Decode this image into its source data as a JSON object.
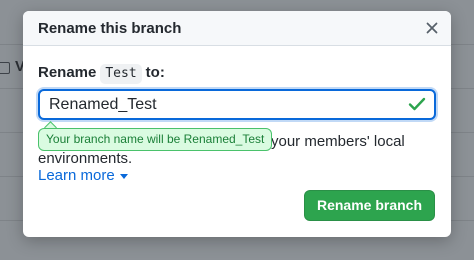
{
  "dialog": {
    "title": "Rename this branch",
    "close_icon": "close-icon"
  },
  "form": {
    "label_prefix": "Rename",
    "current_branch": "Test",
    "label_suffix": "to:",
    "input_value": "Renamed_Test",
    "valid_icon": "check-icon",
    "tooltip": "Your branch name will be Renamed_Test",
    "description_line1": "your members' local",
    "description_line2": "environments.",
    "learn_more": "Learn more",
    "submit_label": "Rename branch"
  },
  "background": {
    "partial_letter": "V"
  },
  "colors": {
    "accent_blue": "#0969da",
    "success_green": "#2da44e",
    "check_green": "#2da44e",
    "tooltip_bg": "#dafbe1",
    "tooltip_text": "#1a7f37"
  }
}
